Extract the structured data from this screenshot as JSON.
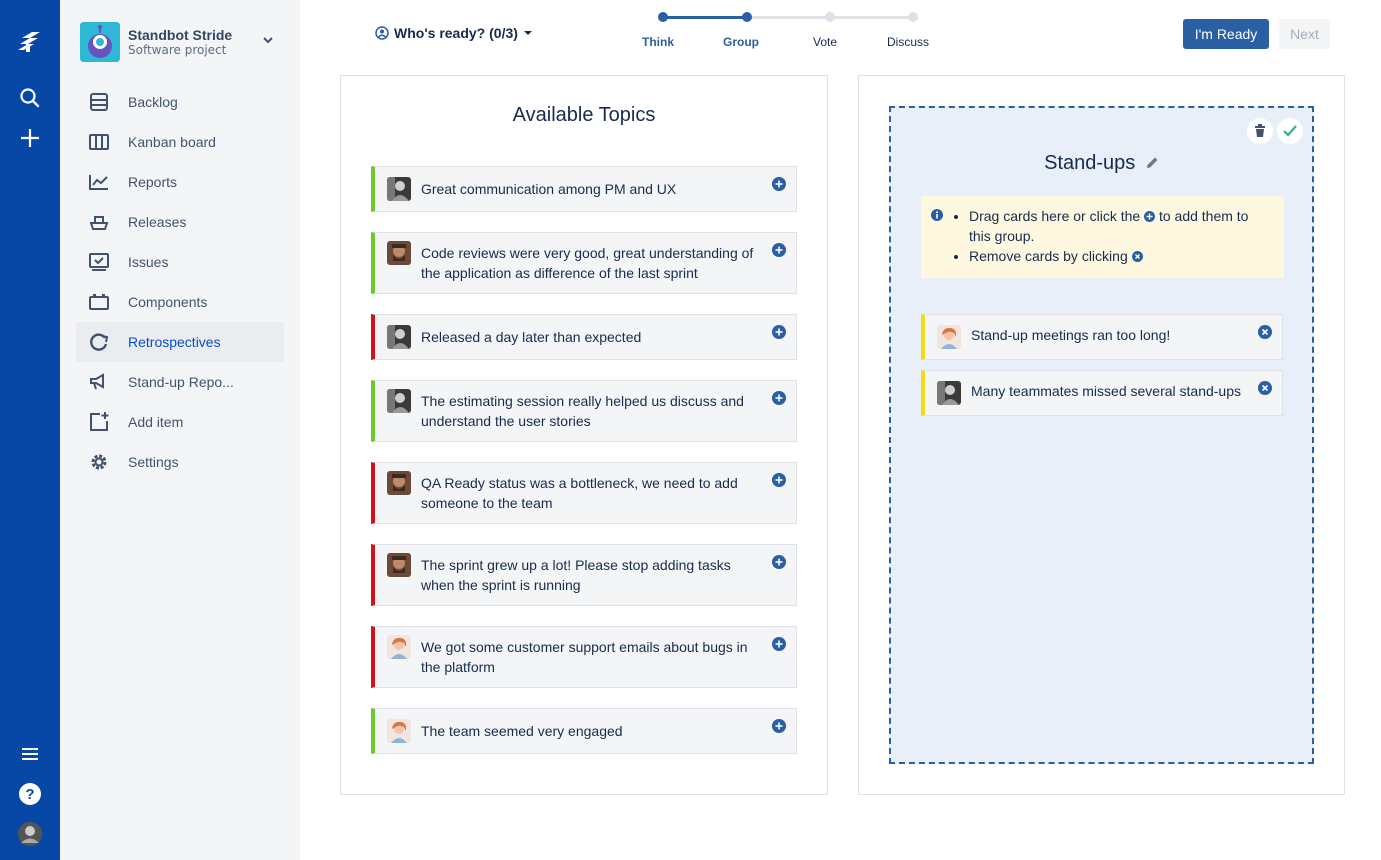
{
  "global_nav": {
    "icons": [
      "jira-logo-icon",
      "search-icon",
      "plus-icon",
      "menu-icon",
      "help-icon",
      "user-avatar"
    ]
  },
  "project": {
    "name": "Standbot Stride",
    "type": "Software project"
  },
  "sidebar": {
    "items": [
      {
        "label": "Backlog",
        "icon": "backlog-icon"
      },
      {
        "label": "Kanban board",
        "icon": "board-icon"
      },
      {
        "label": "Reports",
        "icon": "reports-icon"
      },
      {
        "label": "Releases",
        "icon": "releases-icon"
      },
      {
        "label": "Issues",
        "icon": "issues-icon"
      },
      {
        "label": "Components",
        "icon": "components-icon"
      },
      {
        "label": "Retrospectives",
        "icon": "retrospectives-icon",
        "active": true
      },
      {
        "label": "Stand-up Repo...",
        "icon": "megaphone-icon"
      },
      {
        "label": "Add item",
        "icon": "add-item-icon"
      },
      {
        "label": "Settings",
        "icon": "gear-icon"
      }
    ]
  },
  "header": {
    "who_ready": "Who's ready? (0/3)",
    "steps": [
      {
        "label": "Think",
        "done": true
      },
      {
        "label": "Group",
        "done": true
      },
      {
        "label": "Vote",
        "done": false
      },
      {
        "label": "Discuss",
        "done": false
      }
    ],
    "ready_button": "I'm Ready",
    "next_button": "Next"
  },
  "available": {
    "title": "Available Topics",
    "cards": [
      {
        "text": "Great communication among PM and UX",
        "color": "green"
      },
      {
        "text": "Code reviews were very good, great understanding of the application as difference of the last sprint",
        "color": "green"
      },
      {
        "text": "Released a day later than expected",
        "color": "red"
      },
      {
        "text": "The estimating session really helped us discuss and understand the user stories",
        "color": "green"
      },
      {
        "text": "QA Ready status was a bottleneck, we need to add someone to the team",
        "color": "red"
      },
      {
        "text": "The sprint grew up a lot! Please stop adding tasks when the sprint is running",
        "color": "red"
      },
      {
        "text": "We got some customer support emails about bugs in the platform",
        "color": "red"
      },
      {
        "text": "The team seemed very engaged",
        "color": "green"
      }
    ]
  },
  "group": {
    "title": "Stand-ups",
    "info_line1_a": "Drag cards here or click the",
    "info_line1_b": "to add them to this group.",
    "info_line2": "Remove cards by clicking",
    "cards": [
      {
        "text": "Stand-up meetings ran too long!"
      },
      {
        "text": "Many teammates missed several stand-ups"
      }
    ]
  },
  "colors": {
    "nav_bg": "#0747a6",
    "primary": "#2a5fa3",
    "green": "#6fc82c",
    "red": "#d0121b",
    "yellow": "#f5d816"
  }
}
